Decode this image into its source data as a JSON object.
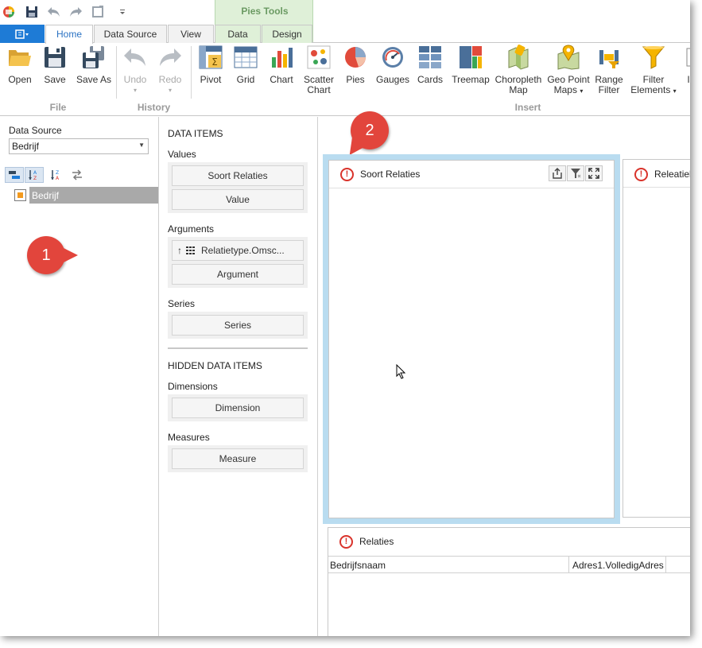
{
  "qat": {
    "icons": [
      "app-logo-icon",
      "save-icon",
      "undo-icon",
      "redo-icon",
      "refresh-icon",
      "customize-qat-icon"
    ]
  },
  "contextual": {
    "title": "Pies Tools"
  },
  "tabs": [
    {
      "label": "Home"
    },
    {
      "label": "Data Source"
    },
    {
      "label": "View"
    },
    {
      "label": "Data"
    },
    {
      "label": "Design"
    }
  ],
  "ribbon": {
    "file": {
      "label": "File",
      "open": "Open",
      "save": "Save",
      "save_as": "Save As"
    },
    "history": {
      "label": "History",
      "undo": "Undo",
      "redo": "Redo"
    },
    "insert": {
      "label": "Insert",
      "pivot": "Pivot",
      "grid": "Grid",
      "chart": "Chart",
      "scatter_1": "Scatter",
      "scatter_2": "Chart",
      "pies": "Pies",
      "gauges": "Gauges",
      "cards": "Cards",
      "treemap": "Treemap",
      "choro_1": "Choropleth",
      "choro_2": "Map",
      "geo_1": "Geo Point",
      "geo_2": "Maps",
      "range_1": "Range",
      "range_2": "Filter",
      "filter_1": "Filter",
      "filter_2": "Elements",
      "cut": "I"
    }
  },
  "datasource": {
    "label": "Data Source",
    "selected": "Bedrijf",
    "tree_item": "Bedrijf"
  },
  "dataitems": {
    "title": "DATA ITEMS",
    "values_label": "Values",
    "values": [
      "Soort Relaties",
      "Value"
    ],
    "arguments_label": "Arguments",
    "argument_field": "Relatietype.Omsc...",
    "argument_placeholder": "Argument",
    "series_label": "Series",
    "series_placeholder": "Series",
    "hidden_title": "HIDDEN DATA ITEMS",
    "dimensions_label": "Dimensions",
    "dimension_placeholder": "Dimension",
    "measures_label": "Measures",
    "measure_placeholder": "Measure"
  },
  "dashboard": {
    "item1_title": "Soort Relaties",
    "item2_title": "Releatieb",
    "item3_title": "Relaties",
    "grid_columns": [
      "Bedrijfsnaam",
      "Adres1.VolledigAdres"
    ]
  },
  "callouts": {
    "one": "1",
    "two": "2"
  },
  "colors": {
    "accent": "#1e7bd6",
    "selection": "#b9dcf0",
    "warning": "#d9332b",
    "callout": "#e2453c",
    "contextual": "#dff0d8"
  }
}
